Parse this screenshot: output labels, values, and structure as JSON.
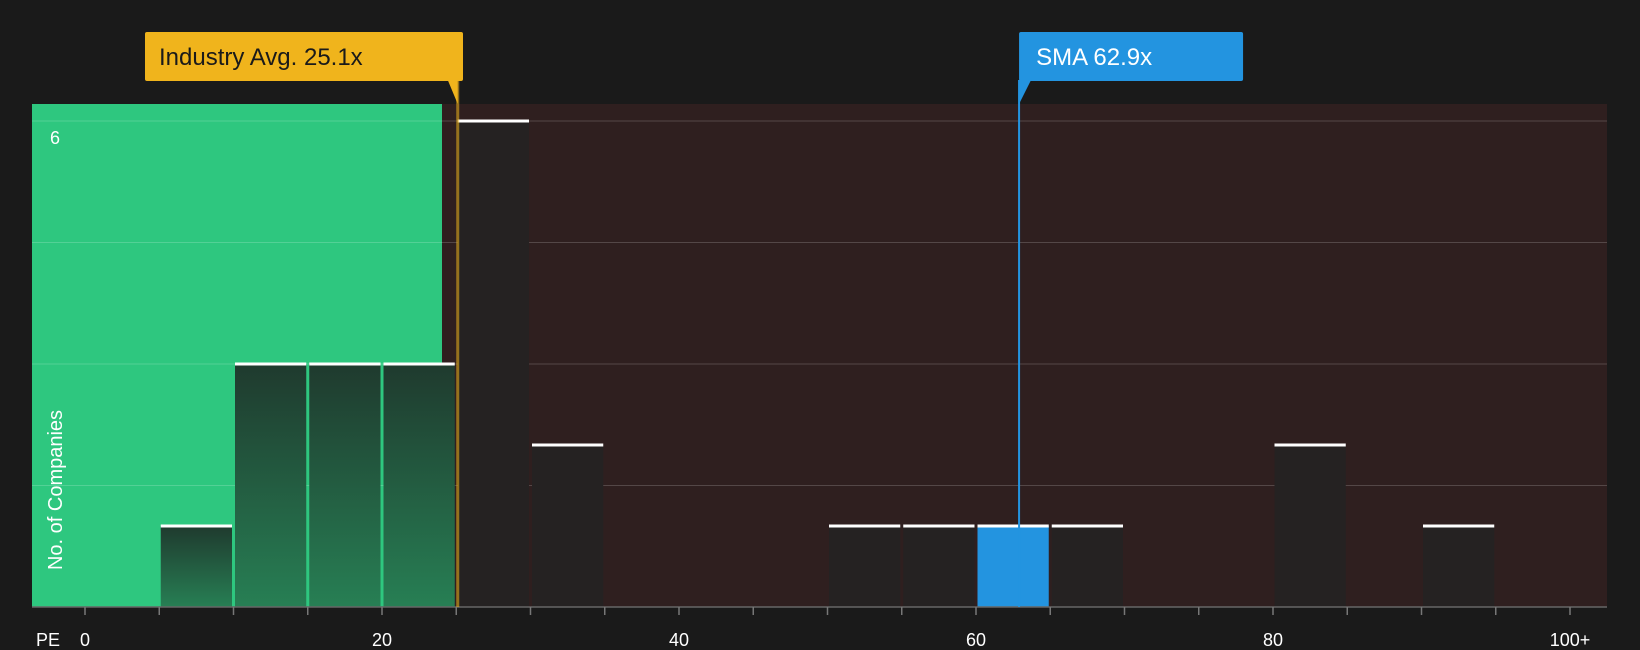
{
  "chart_data": {
    "type": "bar",
    "xlabel": "PE",
    "ylabel": "No. of Companies",
    "x_tick_labels": [
      "0",
      "20",
      "40",
      "60",
      "80",
      "100+"
    ],
    "x_tick_values": [
      0,
      20,
      40,
      60,
      80,
      100
    ],
    "y_tick_labels": [
      "6"
    ],
    "xlim": [
      0,
      100
    ],
    "ylim": [
      0,
      6
    ],
    "bin_width": 5,
    "bins": [
      {
        "start": 5,
        "end": 10,
        "count": 1
      },
      {
        "start": 10,
        "end": 15,
        "count": 3
      },
      {
        "start": 15,
        "end": 20,
        "count": 3
      },
      {
        "start": 20,
        "end": 25,
        "count": 3
      },
      {
        "start": 25,
        "end": 30,
        "count": 6
      },
      {
        "start": 30,
        "end": 35,
        "count": 2
      },
      {
        "start": 50,
        "end": 55,
        "count": 1
      },
      {
        "start": 55,
        "end": 60,
        "count": 1
      },
      {
        "start": 60,
        "end": 65,
        "count": 1,
        "highlight": true
      },
      {
        "start": 65,
        "end": 70,
        "count": 1
      },
      {
        "start": 80,
        "end": 85,
        "count": 2
      },
      {
        "start": 90,
        "end": 95,
        "count": 1
      }
    ],
    "industry_avg": {
      "label": "Industry Avg. 25.1x",
      "value": 25.1,
      "color": "#f0b41c"
    },
    "company": {
      "label": "SMA 62.9x",
      "value": 62.9,
      "color": "#2394e0"
    },
    "colors": {
      "background": "#1a1a1a",
      "undervalued_zone": "#2ec77f",
      "overvalued_zone": "#2f1f1f",
      "bar_dark": "#252222",
      "bar_highlight": "#2394e0",
      "bar_top": "#ffffff"
    },
    "grid": true
  }
}
